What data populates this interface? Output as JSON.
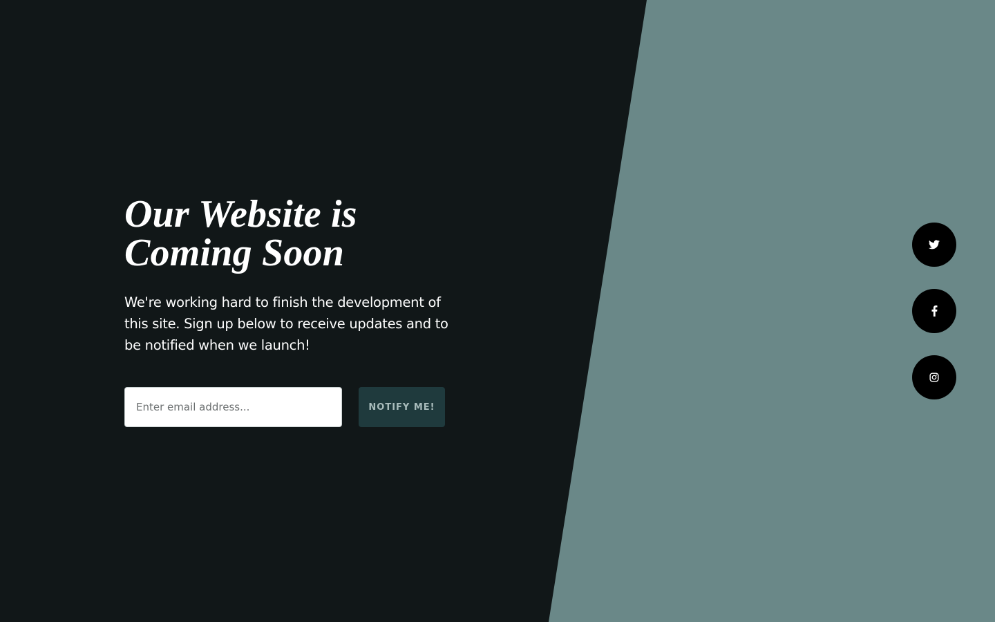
{
  "hero": {
    "title_line1": "Our Website is",
    "title_line2": "Coming Soon",
    "description": "We're working hard to finish the development of this site. Sign up below to receive updates and to be notified when we launch!"
  },
  "form": {
    "email_placeholder": "Enter email address...",
    "email_value": "",
    "submit_label": "NOTIFY ME!"
  },
  "social": [
    {
      "name": "twitter",
      "icon": "twitter-icon"
    },
    {
      "name": "facebook",
      "icon": "facebook-icon"
    },
    {
      "name": "instagram",
      "icon": "instagram-icon"
    }
  ],
  "colors": {
    "background_dark": "#111718",
    "background_accent": "#6a8888",
    "button_bg": "#1f3a3d",
    "button_text": "#a9bcbc",
    "social_bg": "#000000"
  }
}
